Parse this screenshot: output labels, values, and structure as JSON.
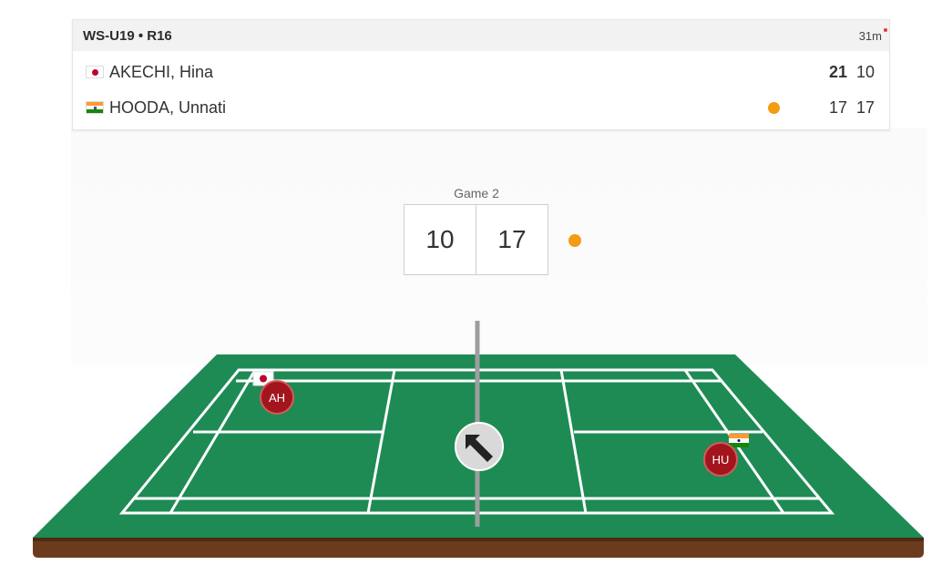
{
  "match": {
    "event": "WS-U19 • R16",
    "duration": "31m"
  },
  "players": [
    {
      "flag": "japan-flag",
      "name": "AKECHI, Hina",
      "games": [
        "21",
        "10"
      ],
      "serving": false
    },
    {
      "flag": "india-flag",
      "name": "HOODA, Unnati",
      "games": [
        "17",
        "17"
      ],
      "serving": true
    }
  ],
  "current_game": {
    "label": "Game 2",
    "left_score": "10",
    "right_score": "17"
  },
  "court": {
    "left_player_initials": "AH",
    "right_player_initials": "HU",
    "direction_icon": "arrow-up-left-icon",
    "colors": {
      "court": "#1e8b54",
      "lines": "#ffffff",
      "base": "#6b3b1e",
      "marker": "#a3151c",
      "serve": "#f39c12"
    }
  }
}
